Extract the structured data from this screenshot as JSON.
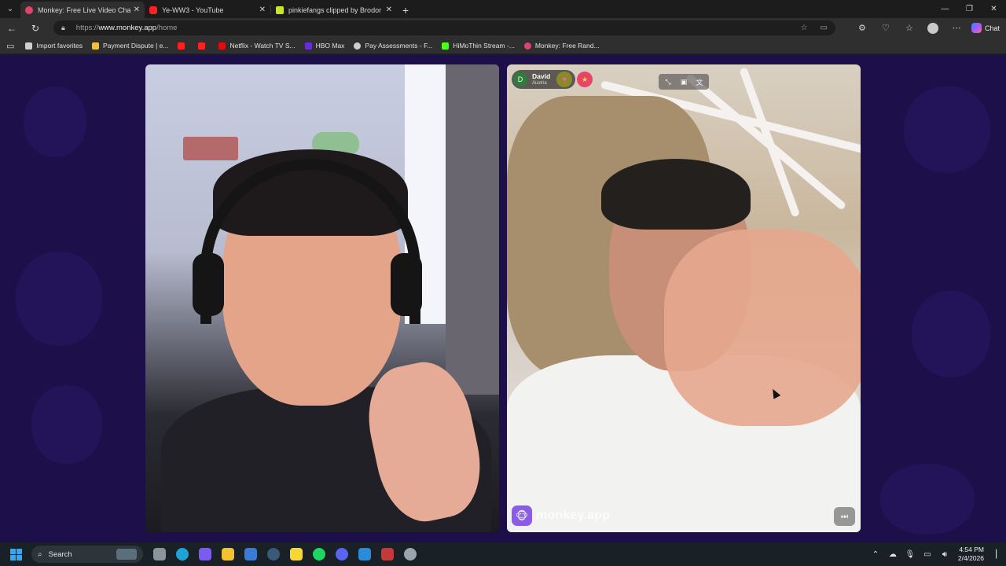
{
  "browser": {
    "tabs": [
      {
        "title": "Monkey: Free Live Video Chat",
        "active": true,
        "favicon_color": "#e0436b"
      },
      {
        "title": "Ye-WW3 - YouTube",
        "active": false,
        "favicon_color": "#ff2020"
      },
      {
        "title": "pinkiefangs clipped by Brodor",
        "active": false,
        "favicon_color": "#c8e62a"
      }
    ],
    "url_scheme": "https://",
    "url_host": "www.monkey.app",
    "url_path": "/home",
    "chat_label": "Chat",
    "bookmarks": [
      {
        "label": "Import favorites",
        "icon": "import-icon",
        "color": "#cfcfcf"
      },
      {
        "label": "Payment Dispute | e...",
        "icon": "doc-icon",
        "color": "#f2c230"
      },
      {
        "label": "",
        "icon": "youtube-icon",
        "color": "#ff2020"
      },
      {
        "label": "",
        "icon": "youtube-icon",
        "color": "#ff2020"
      },
      {
        "label": "Netflix - Watch TV S...",
        "icon": "netflix-icon",
        "color": "#e50914"
      },
      {
        "label": "HBO Max",
        "icon": "hbo-icon",
        "color": "#6a2bd9"
      },
      {
        "label": "Pay Assessments - F...",
        "icon": "globe-icon",
        "color": "#cfcfcf"
      },
      {
        "label": "HiMoThin Stream -...",
        "icon": "kick-icon",
        "color": "#53fc18"
      },
      {
        "label": "Monkey: Free Rand...",
        "icon": "monkey-icon",
        "color": "#e0436b"
      }
    ]
  },
  "app": {
    "peer": {
      "initial": "D",
      "name": "David",
      "location": "Austria"
    },
    "brand_text": "monkey.app"
  },
  "taskbar": {
    "search_label": "Search",
    "time": "4:54 PM",
    "date": "2/4/2026",
    "apps": [
      {
        "name": "task-view",
        "color": "#8a949c"
      },
      {
        "name": "edge",
        "color": "#1fa3d6"
      },
      {
        "name": "copilot",
        "color": "#7a5cf0"
      },
      {
        "name": "file-explorer",
        "color": "#f2c230"
      },
      {
        "name": "store",
        "color": "#3b7bd6"
      },
      {
        "name": "steam",
        "color": "#1b2838"
      },
      {
        "name": "sticky-notes",
        "color": "#f5d833"
      },
      {
        "name": "spotify",
        "color": "#1ed760"
      },
      {
        "name": "discord",
        "color": "#5865f2"
      },
      {
        "name": "photos",
        "color": "#2a8bd9"
      },
      {
        "name": "snipping-tool",
        "color": "#c43a3a"
      },
      {
        "name": "settings",
        "color": "#9aa4ac"
      }
    ]
  }
}
